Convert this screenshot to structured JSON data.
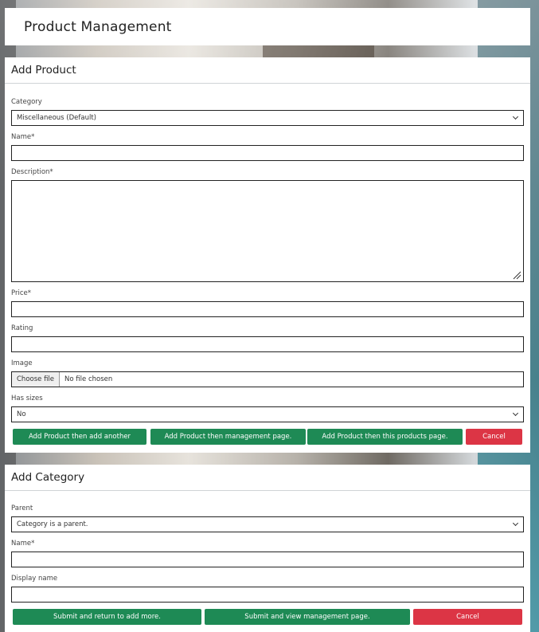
{
  "page": {
    "title": "Product Management"
  },
  "add_product": {
    "title": "Add Product",
    "category": {
      "label": "Category",
      "value": "Miscellaneous (Default)"
    },
    "name": {
      "label": "Name*",
      "value": ""
    },
    "description": {
      "label": "Description*",
      "value": ""
    },
    "price": {
      "label": "Price*",
      "value": ""
    },
    "rating": {
      "label": "Rating",
      "value": ""
    },
    "image": {
      "label": "Image",
      "choose_label": "Choose file",
      "status": "No file chosen"
    },
    "has_sizes": {
      "label": "Has sizes",
      "value": "No"
    },
    "buttons": {
      "add_another": "Add Product then add another",
      "management_page": "Add Product then management page.",
      "this_product": "Add Product then this products page.",
      "cancel": "Cancel"
    }
  },
  "add_category": {
    "title": "Add Category",
    "parent": {
      "label": "Parent",
      "value": "Category is a parent."
    },
    "name": {
      "label": "Name*",
      "value": ""
    },
    "display_name": {
      "label": "Display name",
      "value": ""
    },
    "buttons": {
      "submit_add_more": "Submit and return to add more.",
      "submit_view": "Submit and view management page.",
      "cancel": "Cancel"
    }
  },
  "colors": {
    "primary_button": "#1e8a55",
    "cancel_button": "#dc3545"
  }
}
